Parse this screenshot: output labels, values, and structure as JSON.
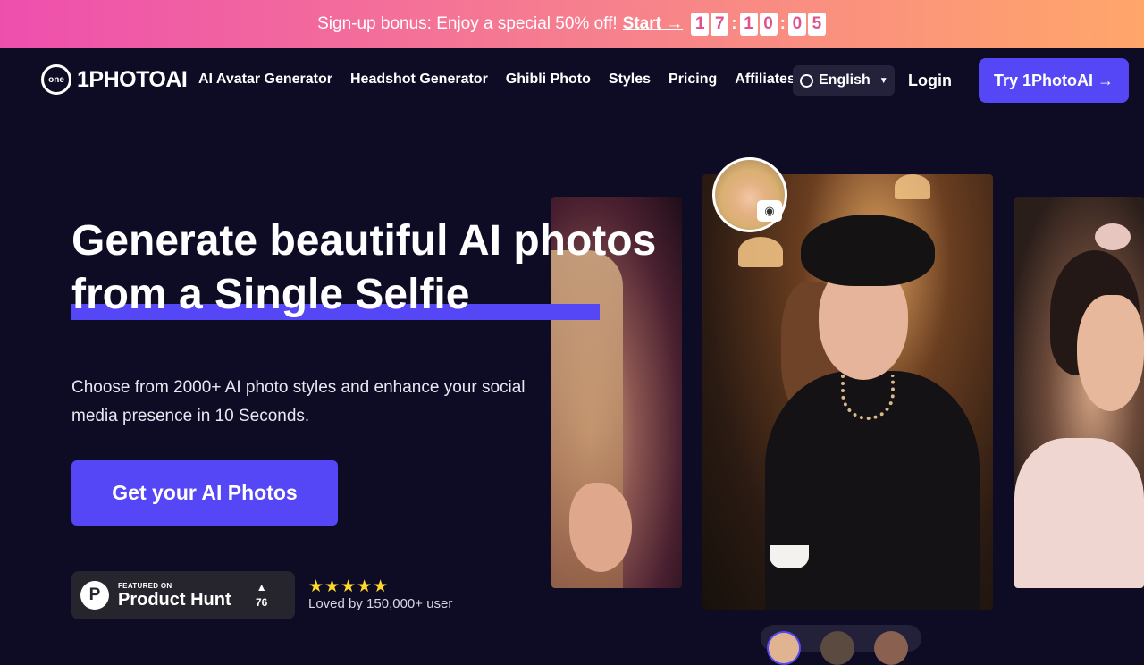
{
  "promo": {
    "text": "Sign-up bonus: Enjoy a special 50% off!",
    "link": "Start →",
    "timer": [
      "1",
      "7",
      "1",
      "0",
      "0",
      "5"
    ]
  },
  "nav": {
    "logo_mark": "one",
    "logo_text": "1PHOTOAI",
    "links": [
      "AI Avatar Generator",
      "Headshot Generator",
      "Ghibli Photo",
      "Styles",
      "Pricing",
      "Affiliates"
    ],
    "language": "English",
    "login": "Login",
    "cta": "Try 1PhotoAI →"
  },
  "hero": {
    "title_line1": "Generate beautiful AI photos",
    "title_line2": "from a Single Selfie",
    "subtitle": "Choose from 2000+ AI photo styles and enhance your social media presence in 10 Seconds.",
    "cta": "Get your AI Photos"
  },
  "product_hunt": {
    "featured": "FEATURED ON",
    "name": "Product Hunt",
    "logo": "P",
    "arrow": "▲",
    "votes": "76"
  },
  "social_proof": {
    "stars": "★★★★★",
    "text": "Loved by 150,000+ user"
  },
  "colors": {
    "accent": "#5546f6",
    "background": "#0e0c25",
    "star": "#ffd92a"
  },
  "icons": {
    "camera": "camera-icon",
    "globe": "globe-icon",
    "caret": "chevron-down-icon"
  }
}
